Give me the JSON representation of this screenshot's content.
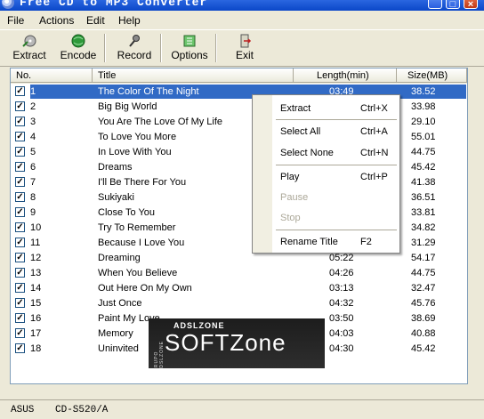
{
  "window": {
    "title": "Free CD to MP3 Converter"
  },
  "menu": [
    "File",
    "Actions",
    "Edit",
    "Help"
  ],
  "toolbar": [
    {
      "label": "Extract",
      "icon": "extract-icon"
    },
    {
      "label": "Encode",
      "icon": "encode-icon"
    },
    {
      "label": "Record",
      "icon": "record-icon"
    },
    {
      "label": "Options",
      "icon": "options-icon"
    },
    {
      "label": "Exit",
      "icon": "exit-icon"
    }
  ],
  "columns": {
    "no": "No.",
    "title": "Title",
    "length": "Length(min)",
    "size": "Size(MB)"
  },
  "tracks": [
    {
      "no": "1",
      "title": "The Color Of The Night",
      "length": "03:49",
      "size": "38.52",
      "checked": true,
      "selected": true
    },
    {
      "no": "2",
      "title": "Big Big World",
      "length": "",
      "size": "33.98",
      "checked": true
    },
    {
      "no": "3",
      "title": "You Are The Love Of My Life",
      "length": "",
      "size": "29.10",
      "checked": true
    },
    {
      "no": "4",
      "title": "To Love You More",
      "length": "",
      "size": "55.01",
      "checked": true
    },
    {
      "no": "5",
      "title": "In Love With You",
      "length": "",
      "size": "44.75",
      "checked": true
    },
    {
      "no": "6",
      "title": "Dreams",
      "length": "",
      "size": "45.42",
      "checked": true
    },
    {
      "no": "7",
      "title": "I'll Be There For You",
      "length": "",
      "size": "41.38",
      "checked": true
    },
    {
      "no": "8",
      "title": "Sukiyaki",
      "length": "",
      "size": "36.51",
      "checked": true
    },
    {
      "no": "9",
      "title": "Close To You",
      "length": "",
      "size": "33.81",
      "checked": true
    },
    {
      "no": "10",
      "title": "Try To Remember",
      "length": "",
      "size": "34.82",
      "checked": true
    },
    {
      "no": "11",
      "title": "Because I Love You",
      "length": "",
      "size": "31.29",
      "checked": true
    },
    {
      "no": "12",
      "title": "Dreaming",
      "length": "05:22",
      "size": "54.17",
      "checked": true
    },
    {
      "no": "13",
      "title": "When You Believe",
      "length": "04:26",
      "size": "44.75",
      "checked": true
    },
    {
      "no": "14",
      "title": "Out Here On My Own",
      "length": "03:13",
      "size": "32.47",
      "checked": true
    },
    {
      "no": "15",
      "title": "Just Once",
      "length": "04:32",
      "size": "45.76",
      "checked": true
    },
    {
      "no": "16",
      "title": "Paint My Love",
      "length": "03:50",
      "size": "38.69",
      "checked": true
    },
    {
      "no": "17",
      "title": "Memory",
      "length": "04:03",
      "size": "40.88",
      "checked": true
    },
    {
      "no": "18",
      "title": "Uninvited",
      "length": "04:30",
      "size": "45.42",
      "checked": true
    }
  ],
  "context_menu": {
    "items": [
      {
        "label": "Extract",
        "shortcut": "Ctrl+X",
        "enabled": true
      },
      {
        "label": "Select All",
        "shortcut": "Ctrl+A",
        "enabled": true
      },
      {
        "label": "Select None",
        "shortcut": "Ctrl+N",
        "enabled": true
      },
      {
        "label": "Play",
        "shortcut": "Ctrl+P",
        "enabled": true
      },
      {
        "label": "Pause",
        "shortcut": "",
        "enabled": false
      },
      {
        "label": "Stop",
        "shortcut": "",
        "enabled": false
      },
      {
        "label": "Rename Title",
        "shortcut": "F2",
        "enabled": true
      }
    ]
  },
  "watermark": {
    "small": "ADSLZONE",
    "big": "SOFTZone",
    "vertical": "GRUPO ADSLZONE"
  },
  "status": {
    "drive_vendor": "ASUS",
    "drive_model": "CD-S520/A"
  },
  "colors": {
    "selection": "#316ac5",
    "titlebar": "#0a47c8",
    "window_bg": "#ece9d8"
  }
}
